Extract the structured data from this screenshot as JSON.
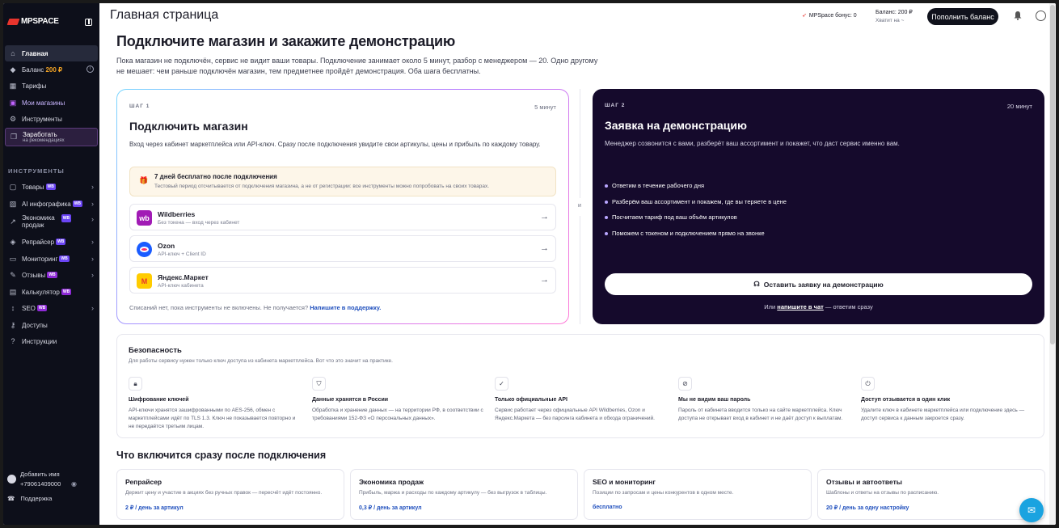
{
  "sidebar": {
    "logo": "MPSPACE",
    "nav_top": [
      {
        "label": "Главная",
        "icon": "home-icon"
      },
      {
        "label": "Баланс",
        "accent": "200 ₽",
        "icon": "diamond-icon"
      },
      {
        "label": "Тарифы",
        "icon": "table-icon"
      },
      {
        "label": "Мои магазины",
        "icon": "store-icon"
      },
      {
        "label": "Инструменты",
        "icon": "gear-icon"
      },
      {
        "label": "Заработать",
        "sub": "на рекомендациях",
        "icon": "gift-icon"
      }
    ],
    "section_title": "ИНСТРУМЕНТЫ",
    "tools": [
      {
        "label": "Товары",
        "badge": "WB"
      },
      {
        "label": "AI инфографика",
        "badge": "WB"
      },
      {
        "label": "Экономика",
        "label2": "продаж",
        "badge": "WB"
      },
      {
        "label": "Репрайсер",
        "badge": "WB"
      },
      {
        "label": "Мониторинг",
        "badge": "WB"
      },
      {
        "label": "Отзывы",
        "badge": "WB"
      },
      {
        "label": "Калькулятор",
        "badge": "WB"
      },
      {
        "label": "SEO",
        "badge": "WB"
      },
      {
        "label": "Доступы"
      },
      {
        "label": "Инструкции"
      }
    ],
    "user_name": "Добавить имя",
    "user_phone": "+79061409000",
    "support": "Поддержка"
  },
  "header": {
    "title": "Главная страница",
    "bonus": "MPSpace бонус: 0",
    "balance": "Баланс: 200 ₽",
    "balance_sub": "Хватит на ~",
    "topup": "Пополнить баланс"
  },
  "hero": {
    "title": "Подключите магазин и закажите демонстрацию",
    "desc": "Пока магазин не подключён, сервис не видит ваши товары. Подключение занимает около 5 минут, разбор с менеджером — 20. Одно другому не мешает: чем раньше подключён магазин, тем предметнее пройдёт демонстрация. Оба шага бесплатны."
  },
  "step1": {
    "tag": "ШАГ 1",
    "time": "5 минут",
    "title": "Подключить магазин",
    "desc": "Вход через кабинет маркетплейса или API-ключ. Сразу после подключения увидите свои артикулы, цены и прибыль по каждому товару.",
    "trial_title": "7 дней бесплатно после подключения",
    "trial_sub": "Тестовый период отсчитывается от подключения магазина, а не от регистрации: все инструменты можно попробовать на своих товарах.",
    "marketplaces": [
      {
        "name": "Wildberries",
        "sub": "Без токена — вход через кабинет",
        "color": "#a11bb5",
        "glyph": "wb"
      },
      {
        "name": "Ozon",
        "sub": "API-ключ + Client ID",
        "color": "#1a5cff",
        "glyph": "O"
      },
      {
        "name": "Яндекс.Маркет",
        "sub": "API-ключ кабинета",
        "color": "#ffcc00",
        "glyph": "М"
      }
    ],
    "foot": "Списаний нет, пока инструменты не включены. Не получается?",
    "foot_link": "Напишите в поддержку."
  },
  "or_label": "и",
  "step2": {
    "tag": "ШАГ 2",
    "time": "20 минут",
    "title": "Заявка на демонстрацию",
    "desc": "Менеджер созвонится с вами, разберёт ваш ассортимент и покажет, что даст сервис именно вам.",
    "bullets": [
      "Ответим в течение рабочего дня",
      "Разберём ваш ассортимент и покажем, где вы теряете в цене",
      "Посчитаем тариф под ваш объём артикулов",
      "Поможем с токеном и подключением прямо на звонке"
    ],
    "button": "Оставить заявку на демонстрацию",
    "foot_pre": "Или",
    "foot_link": "напишите в чат",
    "foot_post": "— ответим сразу"
  },
  "security": {
    "title": "Безопасность",
    "desc": "Для работы сервису нужен только ключ доступа из кабинета маркетплейса. Вот что это значит на практике.",
    "items": [
      {
        "icon": "lock-icon",
        "title": "Шифрование ключей",
        "desc": "API-ключи хранятся зашифрованными по AES-256, обмен с маркетплейсами идёт по TLS 1.3. Ключ не показывается повторно и не передаётся третьим лицам."
      },
      {
        "icon": "shield-icon",
        "title": "Данные хранятся в России",
        "desc": "Обработка и хранение данных — на территории РФ, в соответствии с требованиями 152-ФЗ «О персональных данных»."
      },
      {
        "icon": "check-circle-icon",
        "title": "Только официальные API",
        "desc": "Сервис работает через официальные API Wildberries, Ozon и Яндекс.Маркета — без парсинга кабинета и обхода ограничений."
      },
      {
        "icon": "eye-off-icon",
        "title": "Мы не видим ваш пароль",
        "desc": "Пароль от кабинета вводится только на сайте маркетплейса. Ключ доступа не открывает вход в кабинет и не даёт доступ к выплатам."
      },
      {
        "icon": "power-icon",
        "title": "Доступ отзывается в один клик",
        "desc": "Удалите ключ в кабинете маркетплейса или подключение здесь — доступ сервиса к данным закроется сразу."
      }
    ]
  },
  "after": {
    "title": "Что включится сразу после подключения",
    "features": [
      {
        "title": "Репрайсер",
        "desc": "Держит цену и участие в акциях без ручных правок — пересчёт идёт постоянно.",
        "price": "2 ₽ / день за артикул"
      },
      {
        "title": "Экономика продаж",
        "desc": "Прибыль, маржа и расходы по каждому артикулу — без выгрузок в таблицы.",
        "price": "0,3 ₽ / день за артикул"
      },
      {
        "title": "SEO и мониторинг",
        "desc": "Позиции по запросам и цены конкурентов в одном месте.",
        "price": "бесплатно"
      },
      {
        "title": "Отзывы и автоответы",
        "desc": "Шаблоны и ответы на отзывы по расписанию.",
        "price": "20 ₽ / день за одну настройку"
      }
    ]
  }
}
